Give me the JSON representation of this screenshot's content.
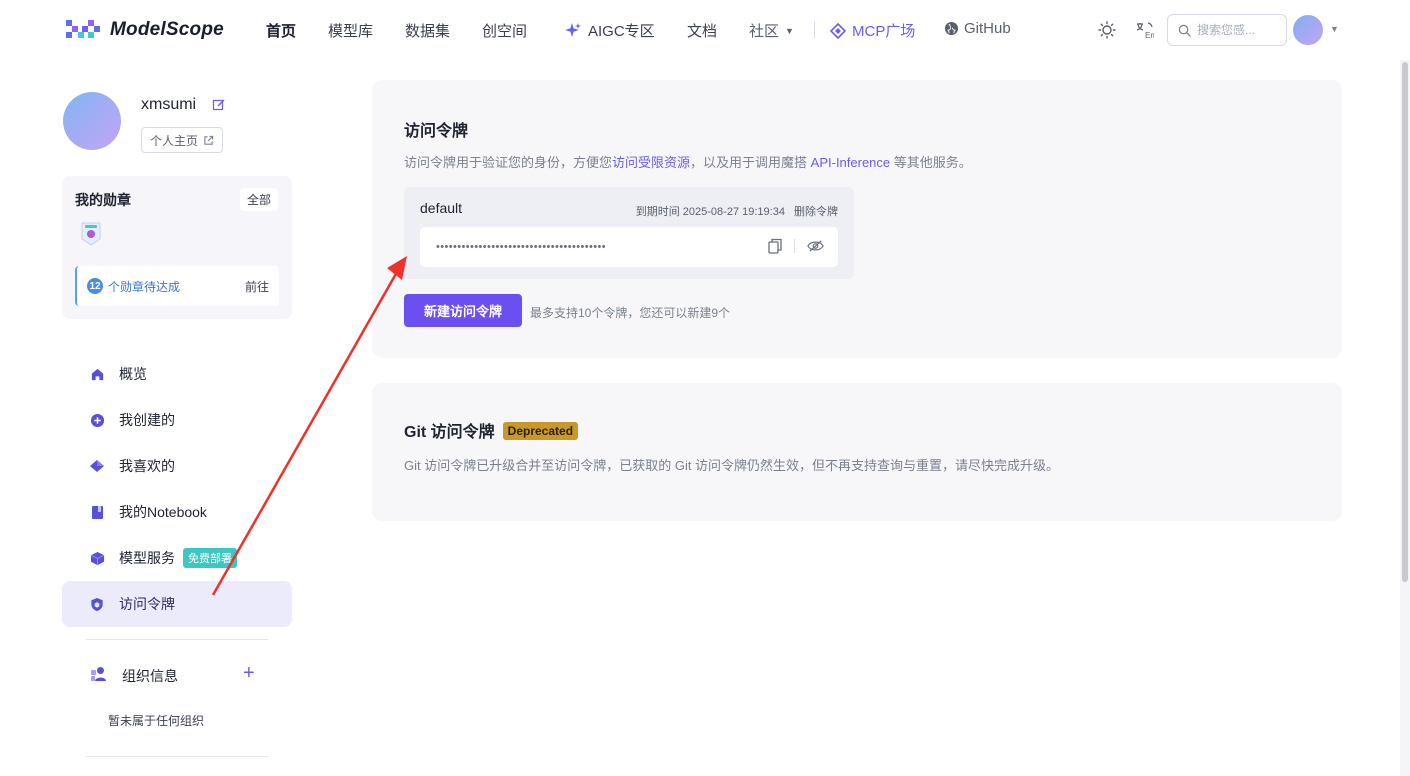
{
  "nav": {
    "logo_text": "ModelScope",
    "items": [
      {
        "label": "首页",
        "active": true
      },
      {
        "label": "模型库"
      },
      {
        "label": "数据集"
      },
      {
        "label": "创空间"
      },
      {
        "label": "AIGC专区"
      },
      {
        "label": "文档"
      },
      {
        "label": "社区"
      },
      {
        "label": "MCP广场"
      },
      {
        "label": "GitHub"
      }
    ],
    "search_placeholder": "搜索您感...",
    "icons": [
      "sun-icon",
      "language-icon",
      "search-icon",
      "avatar",
      "chevron-down-icon"
    ]
  },
  "profile": {
    "username": "xmsumi",
    "homepage_label": "个人主页"
  },
  "badges": {
    "title": "我的勋章",
    "all_label": "全部",
    "pending_count": "12",
    "pending_text": "个勋章待达成",
    "go_label": "前往"
  },
  "menu": {
    "items": [
      {
        "label": "概览",
        "icon": "home-icon"
      },
      {
        "label": "我创建的",
        "icon": "plus-circle-icon"
      },
      {
        "label": "我喜欢的",
        "icon": "diamond-icon"
      },
      {
        "label": "我的Notebook",
        "icon": "notebook-icon"
      },
      {
        "label": "模型服务",
        "icon": "cube-icon",
        "tag": "免费部署"
      },
      {
        "label": "访问令牌",
        "icon": "shield-icon",
        "active": true
      }
    ],
    "org_title": "组织信息",
    "org_empty": "暂未属于任何组织"
  },
  "access_token": {
    "title": "访问令牌",
    "desc_prefix": "访问令牌用于验证您的身份，方便您",
    "desc_link1": "访问受限资源",
    "desc_middle": "，以及用于调用魔搭 ",
    "desc_link2": "API-Inference",
    "desc_suffix": " 等其他服务。",
    "token": {
      "name": "default",
      "expiry_label": "到期时间 2025-08-27 19:19:34",
      "delete_label": "删除令牌",
      "masked_value": "••••••••••••••••••••••••••••••••••••••••"
    },
    "new_button": "新建访问令牌",
    "limit_text": "最多支持10个令牌，您还可以新建9个"
  },
  "git_token": {
    "title": "Git 访问令牌",
    "tag": "Deprecated",
    "desc": "Git 访问令牌已升级合并至访问令牌，已获取的 Git 访问令牌仍然生效，但不再支持查询与重置，请尽快完成升级。"
  },
  "colors": {
    "accent": "#6b4ff0",
    "link": "#6b5cf0",
    "deprecated": "#c9982a",
    "free_tag": "#3cc7c2",
    "annotation_arrow": "#f0302a"
  }
}
